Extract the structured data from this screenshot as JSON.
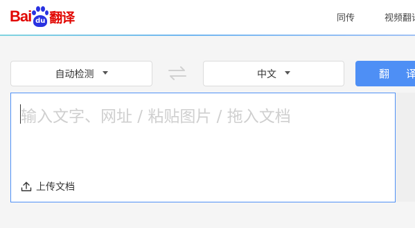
{
  "header": {
    "logo_text_bai": "Bai",
    "logo_text_du": "du",
    "logo_text_fanyi": "翻译",
    "nav": [
      "同传",
      "视频翻译"
    ],
    "brand_red": "#e10601",
    "brand_blue": "#2932e1"
  },
  "toolbar": {
    "source_lang": "自动检测",
    "target_lang": "中文",
    "swap_icon": "swap-arrows-icon",
    "translate_label": "翻译",
    "accent": "#4e8ff5"
  },
  "input": {
    "placeholder": "输入文字、网址 / 粘贴图片 / 拖入文档",
    "value": "",
    "upload_label": "上传文档",
    "upload_icon": "upload-icon"
  }
}
